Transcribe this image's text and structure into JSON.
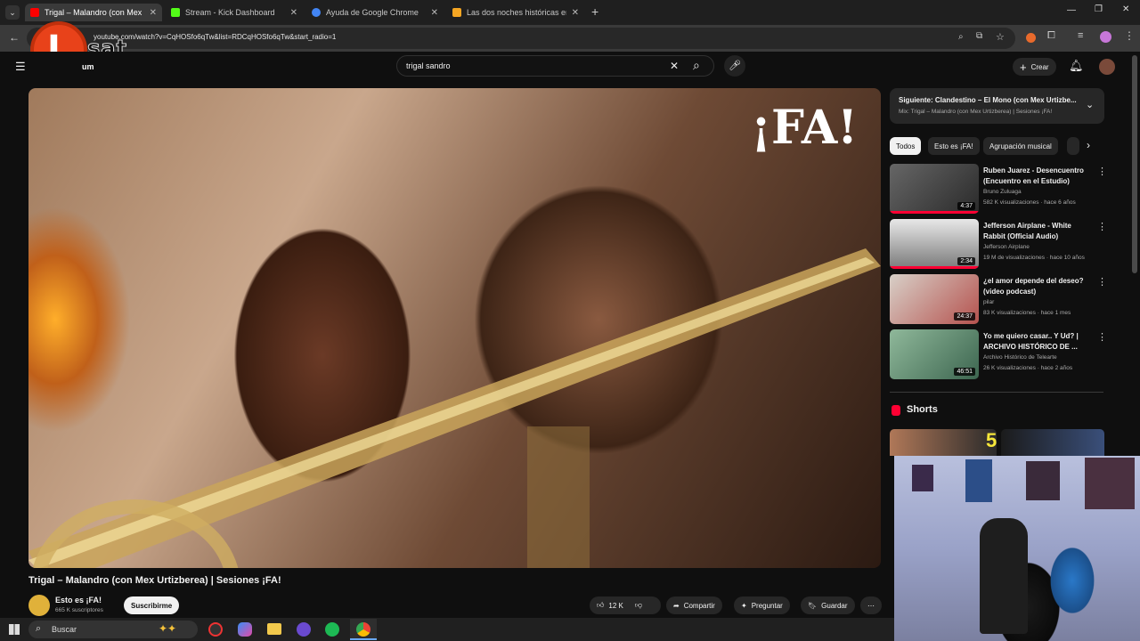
{
  "browser": {
    "tabs": [
      {
        "label": "Trigal – Malandro (con Mex",
        "favicon_color": "#ff0000"
      },
      {
        "label": "Stream - Kick Dashboard",
        "favicon_color": "#53fc18"
      },
      {
        "label": "Ayuda de Google Chrome",
        "favicon_color": "#4285f4"
      },
      {
        "label": "Las dos noches históricas en N",
        "favicon_color": "#f5a623"
      }
    ],
    "url": "youtube.com/watch?v=CqHOSfo6qTw&list=RDCqHOSfo6qTw&start_radio=1"
  },
  "logo": {
    "letter": "I",
    "text": "sat"
  },
  "youtube": {
    "brand_fragment": "um",
    "search_value": "trigal sandro",
    "create_label": "Crear"
  },
  "video": {
    "overlay_logo": "¡FA!",
    "title": "Trigal – Malandro (con Mex Urtizberea) | Sesiones ¡FA!",
    "channel": "Esto es ¡FA!",
    "subscribers": "665 K suscriptores",
    "subscribe_label": "Suscribirme",
    "likes": "12 K",
    "share_label": "Compartir",
    "ask_label": "Preguntar",
    "save_label": "Guardar"
  },
  "playlist": {
    "next_title": "Siguiente: Clandestino – El Mono (con Mex Urtizbe...",
    "mix_title": "Mix: Trigal – Malandro (con Mex Urtizberea) | Sesiones ¡FA!"
  },
  "chips": [
    "Todos",
    "Esto es ¡FA!",
    "Agrupación musical"
  ],
  "recommendations": [
    {
      "title": "Ruben Juarez - Desencuentro (Encuentro en el Estudio)",
      "channel": "Bruno Zuluaga",
      "meta": "582 K visualizaciones · hace 6 años",
      "duration": "4:37",
      "color": "#4a4a4a"
    },
    {
      "title": "Jefferson Airplane - White Rabbit (Official Audio)",
      "channel": "Jefferson Airplane",
      "meta": "19 M de visualizaciones · hace 10 años",
      "duration": "2:34",
      "color": "#d8d8d8"
    },
    {
      "title": "¿el amor depende del deseo? (video podcast)",
      "channel": "pilar",
      "meta": "83 K visualizaciones · hace 1 mes",
      "duration": "24:37",
      "color": "#b5524e"
    },
    {
      "title": "Yo me quiero casar.. Y Ud? | ARCHIVO HISTÓRICO DE ...",
      "channel": "Archivo Histórico de Telearte",
      "meta": "26 K visualizaciones · hace 2 años",
      "duration": "46:51",
      "color": "#5c8a70"
    }
  ],
  "shorts": {
    "label": "Shorts",
    "number": "5"
  },
  "taskbar": {
    "search_label": "Buscar"
  }
}
